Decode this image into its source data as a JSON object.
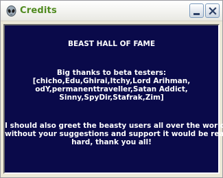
{
  "window": {
    "title": "Credits",
    "icon": "alien-head-icon",
    "buttons": {
      "minimize": "minimize-icon",
      "close": "close-icon"
    }
  },
  "content": {
    "heading": "BEAST HALL OF FAME",
    "thanks_lines": [
      "Big thanks to beta testers:",
      "[chicho,Edu,Ghirai,Itchy,Lord Arihman,",
      "odY,permanenttraveller,Satan Addict,",
      "Sinny,SpyDir,Stafrak,Zim]"
    ],
    "greet_lines": [
      "I should also greet the beasty users all over the world:",
      "without your suggestions and support it would be really",
      "hard, thank you all!"
    ]
  },
  "colors": {
    "title_text": "#4f8a1e",
    "content_background": "#0a0a4a",
    "content_text": "#ffffff",
    "window_frame": "#ece9d8"
  }
}
